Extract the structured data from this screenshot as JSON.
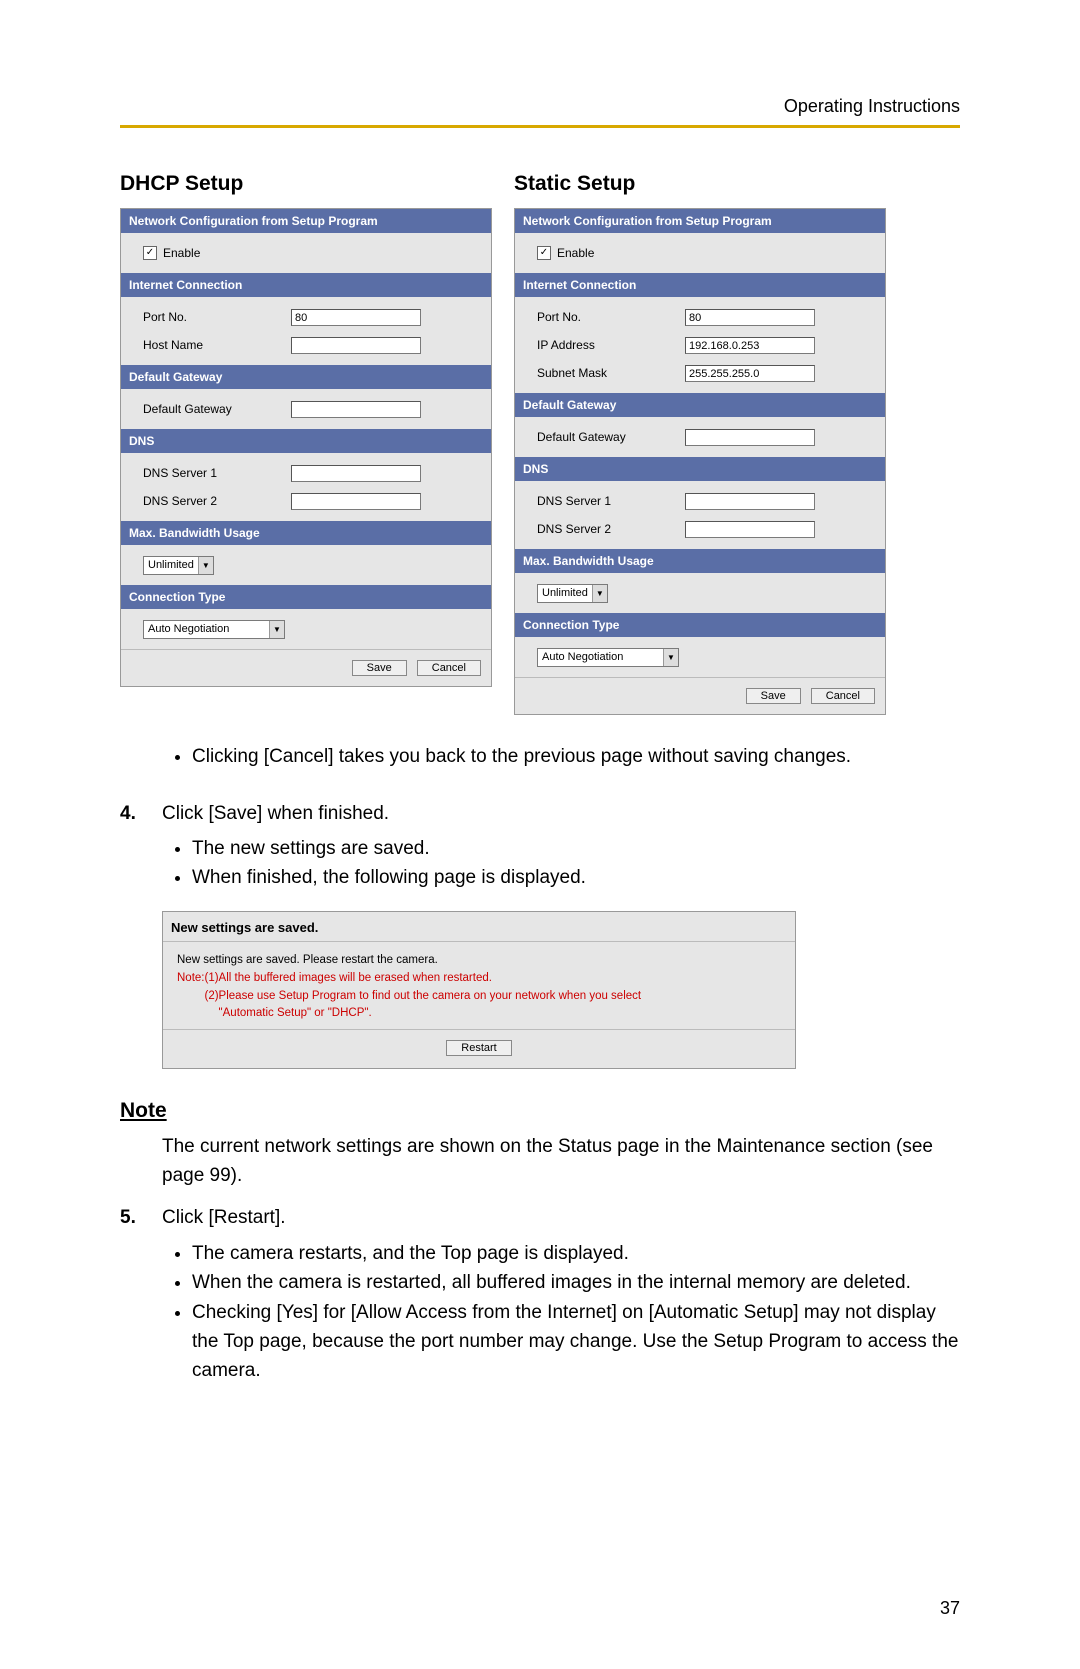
{
  "header": {
    "doc_title": "Operating Instructions"
  },
  "dhcp": {
    "title": "DHCP Setup",
    "sec_netconf": "Network Configuration from Setup Program",
    "enable_label": "Enable",
    "sec_internet": "Internet Connection",
    "port_label": "Port No.",
    "port_value": "80",
    "host_label": "Host Name",
    "host_value": "",
    "sec_gateway": "Default Gateway",
    "gateway_label": "Default Gateway",
    "gateway_value": "",
    "sec_dns": "DNS",
    "dns1_label": "DNS Server 1",
    "dns1_value": "",
    "dns2_label": "DNS Server 2",
    "dns2_value": "",
    "sec_bw": "Max. Bandwidth Usage",
    "bw_value": "Unlimited",
    "sec_conn": "Connection Type",
    "conn_value": "Auto Negotiation",
    "save": "Save",
    "cancel": "Cancel"
  },
  "static": {
    "title": "Static Setup",
    "sec_netconf": "Network Configuration from Setup Program",
    "enable_label": "Enable",
    "sec_internet": "Internet Connection",
    "port_label": "Port No.",
    "port_value": "80",
    "ip_label": "IP Address",
    "ip_value": "192.168.0.253",
    "mask_label": "Subnet Mask",
    "mask_value": "255.255.255.0",
    "sec_gateway": "Default Gateway",
    "gateway_label": "Default Gateway",
    "gateway_value": "",
    "sec_dns": "DNS",
    "dns1_label": "DNS Server 1",
    "dns1_value": "",
    "dns2_label": "DNS Server 2",
    "dns2_value": "",
    "sec_bw": "Max. Bandwidth Usage",
    "bw_value": "Unlimited",
    "sec_conn": "Connection Type",
    "conn_value": "Auto Negotiation",
    "save": "Save",
    "cancel": "Cancel"
  },
  "text": {
    "bullet_cancel": "Clicking [Cancel] takes you back to the previous page without saving changes.",
    "step4_num": "4.",
    "step4": "Click [Save] when finished.",
    "step4_b1": "The new settings are saved.",
    "step4_b2": "When finished, the following page is displayed.",
    "step5_num": "5.",
    "step5": "Click [Restart].",
    "step5_b1": "The camera restarts, and the Top page is displayed.",
    "step5_b2": "When the camera is restarted, all buffered images in the internal memory are deleted.",
    "step5_b3": "Checking [Yes] for [Allow Access from the Internet] on [Automatic Setup] may not display the Top page, because the port number may change. Use the Setup Program to access the camera."
  },
  "saved": {
    "heading": "New settings are saved.",
    "line1": "New settings are saved. Please restart the camera.",
    "note_label": "Note:",
    "note1": "(1)All the buffered images will be erased when restarted.",
    "note2a": "(2)Please use Setup Program to find out the camera on your network when you select",
    "note2b": "\"Automatic Setup\" or \"DHCP\".",
    "restart": "Restart"
  },
  "note": {
    "heading": "Note",
    "body": "The current network settings are shown on the Status page in the Maintenance section (see page 99)."
  },
  "page_number": "37",
  "icons": {
    "check": "✓",
    "down": "▼"
  }
}
